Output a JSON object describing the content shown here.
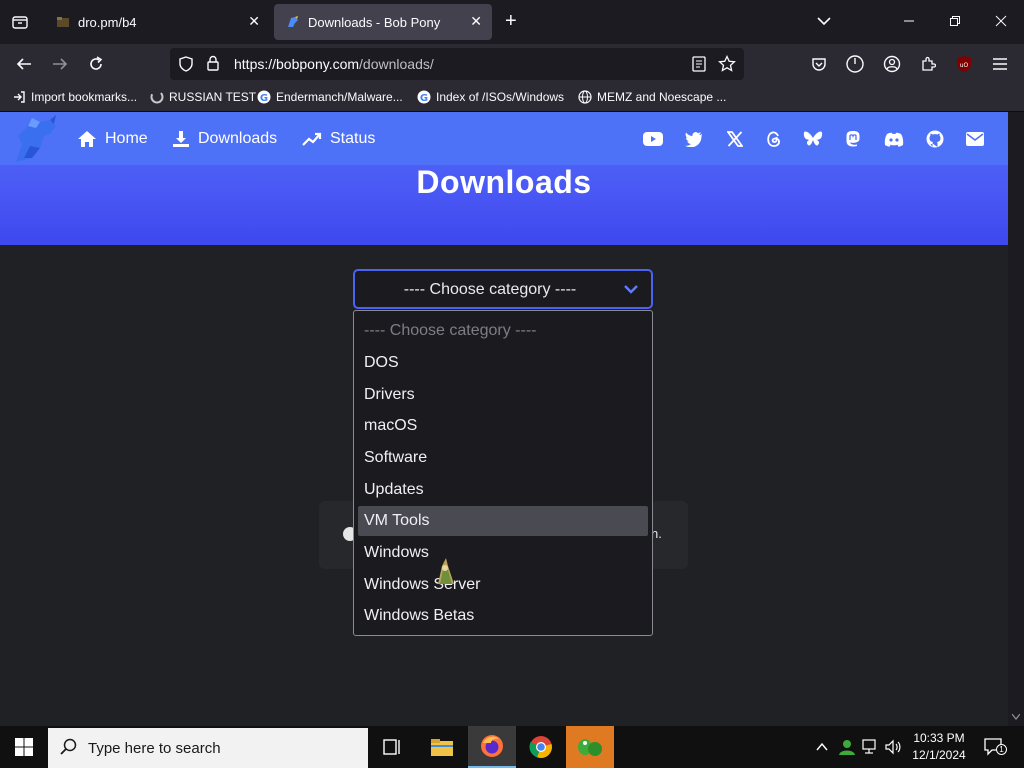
{
  "browser": {
    "tabs": [
      {
        "title": "dro.pm/b4",
        "active": false
      },
      {
        "title": "Downloads - Bob Pony",
        "active": true
      }
    ],
    "url_host": "https://bobpony.com",
    "url_path": "/downloads/",
    "bookmarks": [
      {
        "label": "Import bookmarks...",
        "icon": "import-icon"
      },
      {
        "label": "RUSSIAN TEST",
        "icon": "spinner-icon"
      },
      {
        "label": "Endermanch/Malware...",
        "icon": "google-icon"
      },
      {
        "label": "Index of /ISOs/Windows",
        "icon": "google-icon"
      },
      {
        "label": "MEMZ and Noescape ...",
        "icon": "globe-icon"
      }
    ]
  },
  "site": {
    "nav": [
      {
        "label": "Home",
        "icon": "home-icon"
      },
      {
        "label": "Downloads",
        "icon": "download-icon"
      },
      {
        "label": "Status",
        "icon": "chart-icon"
      }
    ],
    "social_icons": [
      "youtube-icon",
      "twitter-icon",
      "x-icon",
      "threads-icon",
      "bluesky-icon",
      "mastodon-icon",
      "discord-icon",
      "github-icon",
      "email-icon"
    ],
    "hero_title": "Downloads",
    "select_value": "---- Choose category ----",
    "card_tail": "n.",
    "options": [
      {
        "label": "---- Choose category ----",
        "placeholder": true
      },
      {
        "label": "DOS"
      },
      {
        "label": "Drivers"
      },
      {
        "label": "macOS"
      },
      {
        "label": "Software"
      },
      {
        "label": "Updates"
      },
      {
        "label": "VM Tools",
        "highlighted": true
      },
      {
        "label": "Windows"
      },
      {
        "label": "Windows Server"
      },
      {
        "label": "Windows Betas"
      }
    ]
  },
  "taskbar": {
    "search_placeholder": "Type here to search",
    "time": "10:33 PM",
    "date": "12/1/2024",
    "notification_count": "1"
  },
  "colors": {
    "hero_top": "#4d6bf7",
    "hero_bottom": "#3e48ee",
    "accent_border": "#4b62f4",
    "highlight_option": "#4a4a52"
  }
}
